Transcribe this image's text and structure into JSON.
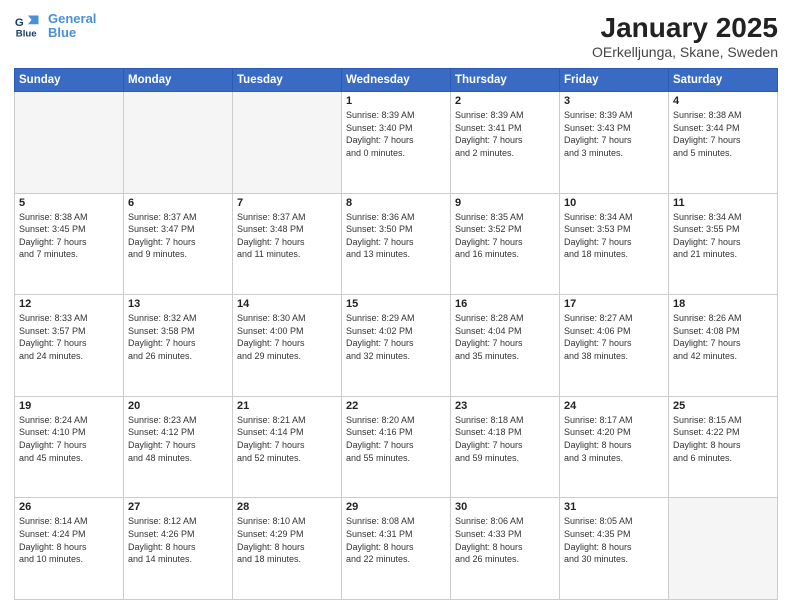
{
  "header": {
    "logo_line1": "General",
    "logo_line2": "Blue",
    "month_title": "January 2025",
    "location": "OErkelljunga, Skane, Sweden"
  },
  "weekdays": [
    "Sunday",
    "Monday",
    "Tuesday",
    "Wednesday",
    "Thursday",
    "Friday",
    "Saturday"
  ],
  "weeks": [
    [
      {
        "day": "",
        "info": ""
      },
      {
        "day": "",
        "info": ""
      },
      {
        "day": "",
        "info": ""
      },
      {
        "day": "1",
        "info": "Sunrise: 8:39 AM\nSunset: 3:40 PM\nDaylight: 7 hours\nand 0 minutes."
      },
      {
        "day": "2",
        "info": "Sunrise: 8:39 AM\nSunset: 3:41 PM\nDaylight: 7 hours\nand 2 minutes."
      },
      {
        "day": "3",
        "info": "Sunrise: 8:39 AM\nSunset: 3:43 PM\nDaylight: 7 hours\nand 3 minutes."
      },
      {
        "day": "4",
        "info": "Sunrise: 8:38 AM\nSunset: 3:44 PM\nDaylight: 7 hours\nand 5 minutes."
      }
    ],
    [
      {
        "day": "5",
        "info": "Sunrise: 8:38 AM\nSunset: 3:45 PM\nDaylight: 7 hours\nand 7 minutes."
      },
      {
        "day": "6",
        "info": "Sunrise: 8:37 AM\nSunset: 3:47 PM\nDaylight: 7 hours\nand 9 minutes."
      },
      {
        "day": "7",
        "info": "Sunrise: 8:37 AM\nSunset: 3:48 PM\nDaylight: 7 hours\nand 11 minutes."
      },
      {
        "day": "8",
        "info": "Sunrise: 8:36 AM\nSunset: 3:50 PM\nDaylight: 7 hours\nand 13 minutes."
      },
      {
        "day": "9",
        "info": "Sunrise: 8:35 AM\nSunset: 3:52 PM\nDaylight: 7 hours\nand 16 minutes."
      },
      {
        "day": "10",
        "info": "Sunrise: 8:34 AM\nSunset: 3:53 PM\nDaylight: 7 hours\nand 18 minutes."
      },
      {
        "day": "11",
        "info": "Sunrise: 8:34 AM\nSunset: 3:55 PM\nDaylight: 7 hours\nand 21 minutes."
      }
    ],
    [
      {
        "day": "12",
        "info": "Sunrise: 8:33 AM\nSunset: 3:57 PM\nDaylight: 7 hours\nand 24 minutes."
      },
      {
        "day": "13",
        "info": "Sunrise: 8:32 AM\nSunset: 3:58 PM\nDaylight: 7 hours\nand 26 minutes."
      },
      {
        "day": "14",
        "info": "Sunrise: 8:30 AM\nSunset: 4:00 PM\nDaylight: 7 hours\nand 29 minutes."
      },
      {
        "day": "15",
        "info": "Sunrise: 8:29 AM\nSunset: 4:02 PM\nDaylight: 7 hours\nand 32 minutes."
      },
      {
        "day": "16",
        "info": "Sunrise: 8:28 AM\nSunset: 4:04 PM\nDaylight: 7 hours\nand 35 minutes."
      },
      {
        "day": "17",
        "info": "Sunrise: 8:27 AM\nSunset: 4:06 PM\nDaylight: 7 hours\nand 38 minutes."
      },
      {
        "day": "18",
        "info": "Sunrise: 8:26 AM\nSunset: 4:08 PM\nDaylight: 7 hours\nand 42 minutes."
      }
    ],
    [
      {
        "day": "19",
        "info": "Sunrise: 8:24 AM\nSunset: 4:10 PM\nDaylight: 7 hours\nand 45 minutes."
      },
      {
        "day": "20",
        "info": "Sunrise: 8:23 AM\nSunset: 4:12 PM\nDaylight: 7 hours\nand 48 minutes."
      },
      {
        "day": "21",
        "info": "Sunrise: 8:21 AM\nSunset: 4:14 PM\nDaylight: 7 hours\nand 52 minutes."
      },
      {
        "day": "22",
        "info": "Sunrise: 8:20 AM\nSunset: 4:16 PM\nDaylight: 7 hours\nand 55 minutes."
      },
      {
        "day": "23",
        "info": "Sunrise: 8:18 AM\nSunset: 4:18 PM\nDaylight: 7 hours\nand 59 minutes."
      },
      {
        "day": "24",
        "info": "Sunrise: 8:17 AM\nSunset: 4:20 PM\nDaylight: 8 hours\nand 3 minutes."
      },
      {
        "day": "25",
        "info": "Sunrise: 8:15 AM\nSunset: 4:22 PM\nDaylight: 8 hours\nand 6 minutes."
      }
    ],
    [
      {
        "day": "26",
        "info": "Sunrise: 8:14 AM\nSunset: 4:24 PM\nDaylight: 8 hours\nand 10 minutes."
      },
      {
        "day": "27",
        "info": "Sunrise: 8:12 AM\nSunset: 4:26 PM\nDaylight: 8 hours\nand 14 minutes."
      },
      {
        "day": "28",
        "info": "Sunrise: 8:10 AM\nSunset: 4:29 PM\nDaylight: 8 hours\nand 18 minutes."
      },
      {
        "day": "29",
        "info": "Sunrise: 8:08 AM\nSunset: 4:31 PM\nDaylight: 8 hours\nand 22 minutes."
      },
      {
        "day": "30",
        "info": "Sunrise: 8:06 AM\nSunset: 4:33 PM\nDaylight: 8 hours\nand 26 minutes."
      },
      {
        "day": "31",
        "info": "Sunrise: 8:05 AM\nSunset: 4:35 PM\nDaylight: 8 hours\nand 30 minutes."
      },
      {
        "day": "",
        "info": ""
      }
    ]
  ]
}
